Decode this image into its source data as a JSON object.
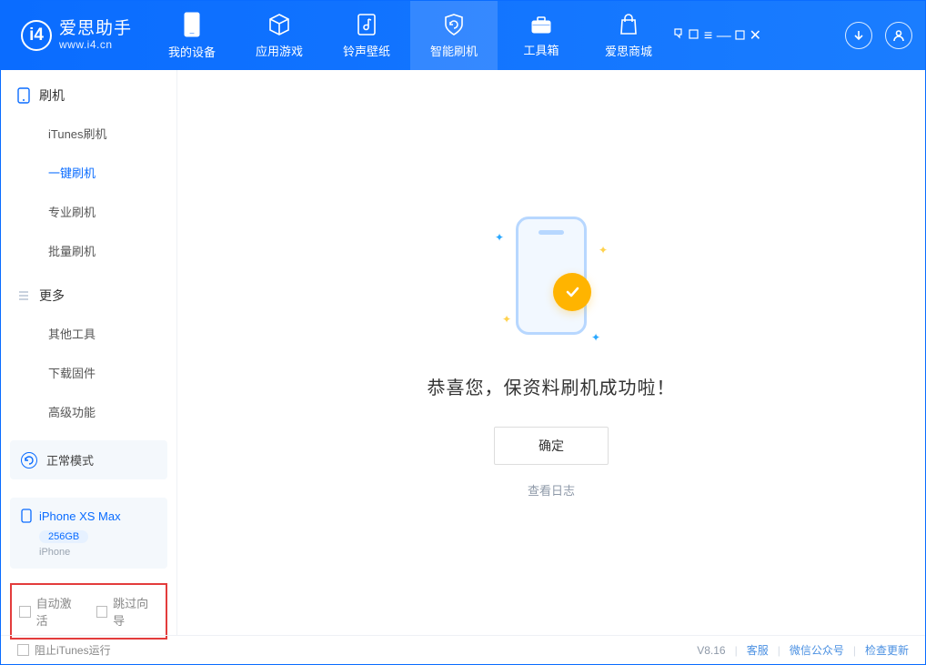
{
  "colors": {
    "primary": "#0a6cff",
    "accent": "#ffb400"
  },
  "header": {
    "logo_cn": "爱思助手",
    "logo_url": "www.i4.cn",
    "nav": [
      {
        "label": "我的设备"
      },
      {
        "label": "应用游戏"
      },
      {
        "label": "铃声壁纸"
      },
      {
        "label": "智能刷机",
        "active": true
      },
      {
        "label": "工具箱"
      },
      {
        "label": "爱思商城"
      }
    ]
  },
  "sidebar": {
    "group1_title": "刷机",
    "group1_items": [
      {
        "label": "iTunes刷机"
      },
      {
        "label": "一键刷机",
        "active": true
      },
      {
        "label": "专业刷机"
      },
      {
        "label": "批量刷机"
      }
    ],
    "group2_title": "更多",
    "group2_items": [
      {
        "label": "其他工具"
      },
      {
        "label": "下载固件"
      },
      {
        "label": "高级功能"
      }
    ],
    "mode_label": "正常模式",
    "device": {
      "name": "iPhone XS Max",
      "capacity": "256GB",
      "type": "iPhone"
    },
    "auto_activate_label": "自动激活",
    "skip_wizard_label": "跳过向导"
  },
  "main": {
    "success_title": "恭喜您，保资料刷机成功啦！",
    "ok_button": "确定",
    "view_log": "查看日志"
  },
  "statusbar": {
    "block_itunes": "阻止iTunes运行",
    "version": "V8.16",
    "links": [
      "客服",
      "微信公众号",
      "检查更新"
    ]
  }
}
